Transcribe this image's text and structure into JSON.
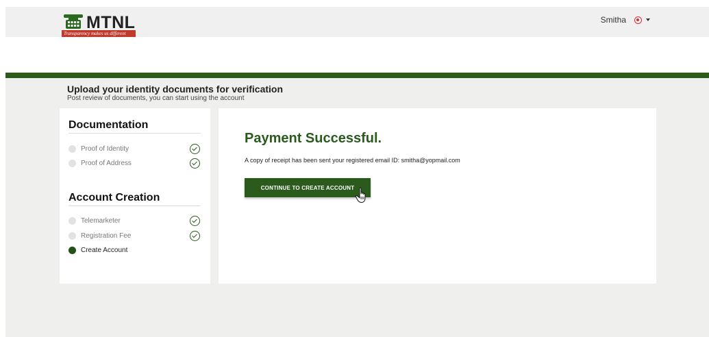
{
  "header": {
    "brand": "MTNL",
    "tagline": "Transparency makes us different",
    "user_name": "Smitha",
    "user_icon": "user-circle-icon"
  },
  "page": {
    "title": "Upload your identity documents for verification",
    "subtitle": "Post review of documents, you can start using the account"
  },
  "sidebar": {
    "documentation": {
      "title": "Documentation",
      "steps": [
        {
          "label": "Proof of Identity",
          "status": "done"
        },
        {
          "label": "Proof of Address",
          "status": "done"
        }
      ]
    },
    "account_creation": {
      "title": "Account Creation",
      "steps": [
        {
          "label": "Telemarketer",
          "status": "done"
        },
        {
          "label": "Registration Fee",
          "status": "done"
        },
        {
          "label": "Create Account",
          "status": "current"
        }
      ]
    }
  },
  "main": {
    "title": "Payment Successful.",
    "message": "A copy of receipt has been sent your registered email ID: smitha@yopmail.com",
    "button_label": "CONTINUE TO CREATE ACCOUNT"
  },
  "colors": {
    "brand_green": "#2a5a1c",
    "brand_red": "#c0392b",
    "background": "#efefed"
  }
}
